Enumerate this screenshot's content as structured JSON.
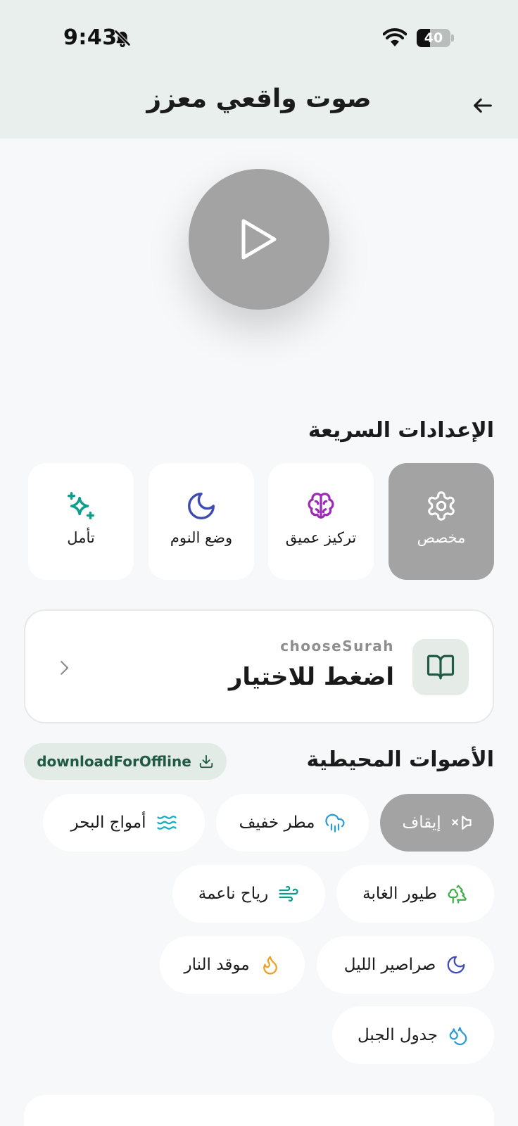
{
  "status_bar": {
    "time": "9:43",
    "battery": "40",
    "battery_level": 0.4
  },
  "header": {
    "title": "صوت واقعي معزز"
  },
  "quick_settings": {
    "title": "الإعدادات السريعة",
    "items": [
      {
        "label": "مخصص",
        "icon": "gear-icon",
        "active": true
      },
      {
        "label": "تركيز عميق",
        "icon": "brain-icon",
        "active": false
      },
      {
        "label": "وضع النوم",
        "icon": "moon-icon",
        "active": false
      },
      {
        "label": "تأمل",
        "icon": "sparkle-icon",
        "active": false
      }
    ]
  },
  "surah": {
    "subtitle": "chooseSurah",
    "label": "اضغط للاختيار"
  },
  "ambient": {
    "title": "الأصوات المحيطية",
    "download_label": "downloadForOffline",
    "chips": [
      {
        "label": "إيقاف",
        "icon": "mute-icon",
        "active": true
      },
      {
        "label": "مطر خفيف",
        "icon": "rain-icon",
        "active": false
      },
      {
        "label": "أمواج البحر",
        "icon": "waves-icon",
        "active": false
      },
      {
        "label": "طيور الغابة",
        "icon": "trees-icon",
        "active": false
      },
      {
        "label": "رياح ناعمة",
        "icon": "wind-icon",
        "active": false
      },
      {
        "label": "صراصير الليل",
        "icon": "moon-icon",
        "active": false
      },
      {
        "label": "موقد النار",
        "icon": "flame-icon",
        "active": false
      },
      {
        "label": "جدول الجبل",
        "icon": "droplets-icon",
        "active": false
      }
    ]
  },
  "colors": {
    "teal": "#0e9f8a",
    "purple": "#9b2bb5",
    "indigo": "#3f4bb5",
    "blue": "#2b9bd6",
    "green": "#3fae4a",
    "orange": "#f0a020",
    "gray_active": "#a3a3a3"
  }
}
